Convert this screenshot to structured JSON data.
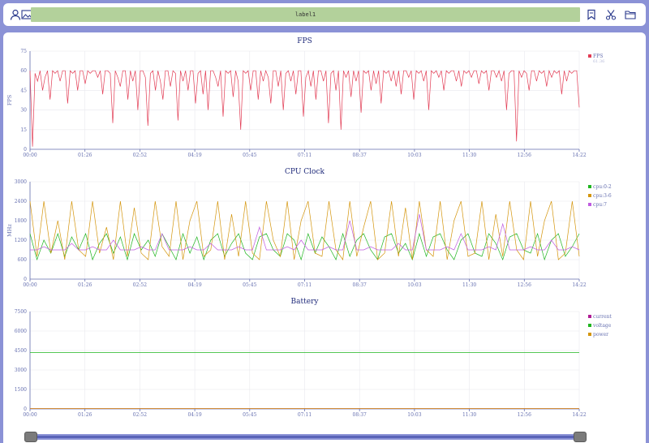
{
  "toolbar": {
    "label": "label1",
    "icons": [
      "user-icon",
      "image-icon",
      "bookmark-icon",
      "scissors-icon",
      "folder-icon"
    ]
  },
  "colors": {
    "fps": "#e23c54",
    "cpu_0_2": "#1fb51f",
    "cpu_3_6": "#d4950c",
    "cpu_7": "#c05ce0",
    "current": "#b01c94",
    "voltage": "#1fb51f",
    "power": "#d4950c",
    "accent": "#8b92d6"
  },
  "chart_data": [
    {
      "type": "line",
      "title": "FPS",
      "ylabel": "FPS",
      "ylim": [
        0,
        75
      ],
      "yticks": [
        "0",
        "15",
        "30",
        "45",
        "60",
        "75"
      ],
      "xticks": [
        "00:00",
        "01:26",
        "02:52",
        "04:19",
        "05:45",
        "07:11",
        "08:37",
        "10:03",
        "11:30",
        "12:56",
        "14:22"
      ],
      "legend": [
        {
          "name": "FPS",
          "sub": "61.36",
          "color": "#e23c54"
        }
      ],
      "series": [
        {
          "name": "FPS",
          "color": "#e23c54",
          "values": [
            60,
            2,
            58,
            52,
            60,
            45,
            55,
            60,
            38,
            60,
            58,
            60,
            52,
            60,
            60,
            35,
            60,
            58,
            60,
            45,
            60,
            60,
            50,
            60,
            58,
            60,
            60,
            55,
            60,
            42,
            60,
            60,
            58,
            20,
            60,
            55,
            48,
            60,
            60,
            38,
            60,
            52,
            60,
            30,
            60,
            60,
            55,
            18,
            58,
            60,
            45,
            60,
            52,
            38,
            60,
            60,
            48,
            60,
            58,
            22,
            60,
            52,
            60,
            45,
            60,
            60,
            35,
            58,
            60,
            42,
            60,
            30,
            60,
            60,
            55,
            48,
            60,
            25,
            60,
            58,
            60,
            40,
            60,
            52,
            15,
            60,
            58,
            60,
            45,
            60,
            60,
            38,
            60,
            52,
            60,
            55,
            35,
            60,
            60,
            48,
            60,
            30,
            58,
            60,
            52,
            60,
            42,
            60,
            60,
            25,
            55,
            60,
            48,
            60,
            38,
            60,
            60,
            52,
            60,
            20,
            58,
            60,
            45,
            60,
            15,
            60,
            55,
            60,
            40,
            60,
            52,
            60,
            28,
            60,
            58,
            60,
            45,
            60,
            50,
            60,
            35,
            60,
            58,
            60,
            52,
            60,
            48,
            60,
            42,
            60,
            60,
            55,
            60,
            38,
            60,
            58,
            60,
            52,
            60,
            30,
            60,
            58,
            60,
            55,
            60,
            45,
            60,
            58,
            60,
            60,
            52,
            60,
            48,
            60,
            58,
            60,
            55,
            60,
            60,
            50,
            60,
            58,
            60,
            45,
            60,
            60,
            55,
            60,
            52,
            60,
            30,
            58,
            60,
            60,
            6,
            60,
            55,
            60,
            58,
            45,
            60,
            60,
            52,
            60,
            58,
            60,
            48,
            60,
            55,
            60,
            58,
            60,
            42,
            60,
            52,
            60,
            58,
            60,
            60,
            32
          ]
        }
      ]
    },
    {
      "type": "line",
      "title": "CPU Clock",
      "ylabel": "MHz",
      "ylim": [
        0,
        3000
      ],
      "yticks": [
        "0",
        "600",
        "1200",
        "1800",
        "2400",
        "3000"
      ],
      "xticks": [
        "00:00",
        "01:26",
        "02:52",
        "04:19",
        "05:45",
        "07:11",
        "08:37",
        "10:03",
        "11:30",
        "12:56",
        "14:22"
      ],
      "legend": [
        {
          "name": "cpu:0-2",
          "color": "#1fb51f"
        },
        {
          "name": "cpu:3-6",
          "color": "#d4950c"
        },
        {
          "name": "cpu:7",
          "color": "#c05ce0"
        }
      ],
      "series": [
        {
          "name": "cpu:0-2",
          "color": "#1fb51f",
          "values": [
            1400,
            600,
            1200,
            800,
            1400,
            700,
            1300,
            900,
            1400,
            600,
            1100,
            1400,
            800,
            1300,
            600,
            1400,
            900,
            1200,
            700,
            1400,
            1000,
            600,
            1400,
            800,
            1300,
            600,
            1200,
            1400,
            700,
            1100,
            1400,
            800,
            600,
            1300,
            1400,
            900,
            700,
            1400,
            1200,
            600,
            1400,
            800,
            1300,
            1000,
            600,
            1400,
            700,
            1200,
            1400,
            900,
            600,
            1300,
            1400,
            800,
            1100,
            600,
            1400,
            700,
            1300,
            1400,
            900,
            600,
            1200,
            1400,
            800,
            700,
            1400,
            1100,
            600,
            1300,
            1400,
            900,
            800,
            1400,
            600,
            1200,
            1400,
            700,
            1000,
            1400
          ]
        },
        {
          "name": "cpu:3-6",
          "color": "#d4950c",
          "values": [
            2400,
            700,
            2400,
            800,
            1800,
            600,
            2400,
            900,
            700,
            2400,
            800,
            1600,
            600,
            2400,
            700,
            2200,
            800,
            600,
            2400,
            1000,
            700,
            2400,
            600,
            1800,
            2400,
            700,
            900,
            2400,
            600,
            2000,
            700,
            2400,
            800,
            600,
            2400,
            1200,
            700,
            2400,
            600,
            1800,
            2400,
            800,
            700,
            2400,
            900,
            600,
            2400,
            700,
            1600,
            2400,
            600,
            800,
            2400,
            700,
            2200,
            600,
            2400,
            900,
            700,
            2400,
            600,
            1800,
            2400,
            700,
            800,
            2400,
            600,
            2000,
            700,
            2400,
            900,
            600,
            2400,
            700,
            1800,
            2400,
            600,
            800,
            2400,
            700
          ]
        },
        {
          "name": "cpu:7",
          "color": "#c05ce0",
          "values": [
            900,
            900,
            1000,
            900,
            900,
            900,
            1100,
            900,
            900,
            1000,
            900,
            900,
            1200,
            900,
            900,
            900,
            1000,
            900,
            900,
            1400,
            900,
            900,
            900,
            1000,
            900,
            900,
            1100,
            900,
            900,
            900,
            1000,
            900,
            900,
            1600,
            900,
            900,
            900,
            1000,
            900,
            1200,
            900,
            900,
            900,
            1000,
            900,
            900,
            1800,
            900,
            900,
            1000,
            900,
            900,
            900,
            1100,
            900,
            900,
            2000,
            900,
            900,
            900,
            1000,
            900,
            1400,
            900,
            900,
            900,
            1000,
            900,
            1700,
            900,
            900,
            900,
            1000,
            900,
            900,
            1200,
            900,
            900,
            1000,
            900
          ]
        }
      ]
    },
    {
      "type": "line",
      "title": "Battery",
      "ylabel": "",
      "ylim": [
        0,
        7500
      ],
      "yticks": [
        "0",
        "1500",
        "3000",
        "4500",
        "6000",
        "7500"
      ],
      "xticks": [
        "00:00",
        "01:26",
        "02:52",
        "04:19",
        "05:45",
        "07:11",
        "08:37",
        "10:03",
        "11:30",
        "12:56",
        "14:22"
      ],
      "legend": [
        {
          "name": "current",
          "color": "#b01c94"
        },
        {
          "name": "voltage",
          "color": "#1fb51f"
        },
        {
          "name": "power",
          "color": "#d4950c"
        }
      ],
      "series": [
        {
          "name": "current",
          "color": "#b01c94",
          "values": [
            20,
            20,
            20,
            20,
            20,
            20,
            20,
            20,
            20,
            20,
            20
          ]
        },
        {
          "name": "voltage",
          "color": "#1fb51f",
          "values": [
            4350,
            4350,
            4350,
            4345,
            4345,
            4345,
            4340,
            4340,
            4340,
            4335,
            4335
          ]
        },
        {
          "name": "power",
          "color": "#d4950c",
          "values": [
            30,
            30,
            30,
            30,
            30,
            30,
            30,
            30,
            30,
            30,
            30
          ]
        }
      ]
    }
  ],
  "slider": {
    "start": 0,
    "end": 1
  }
}
